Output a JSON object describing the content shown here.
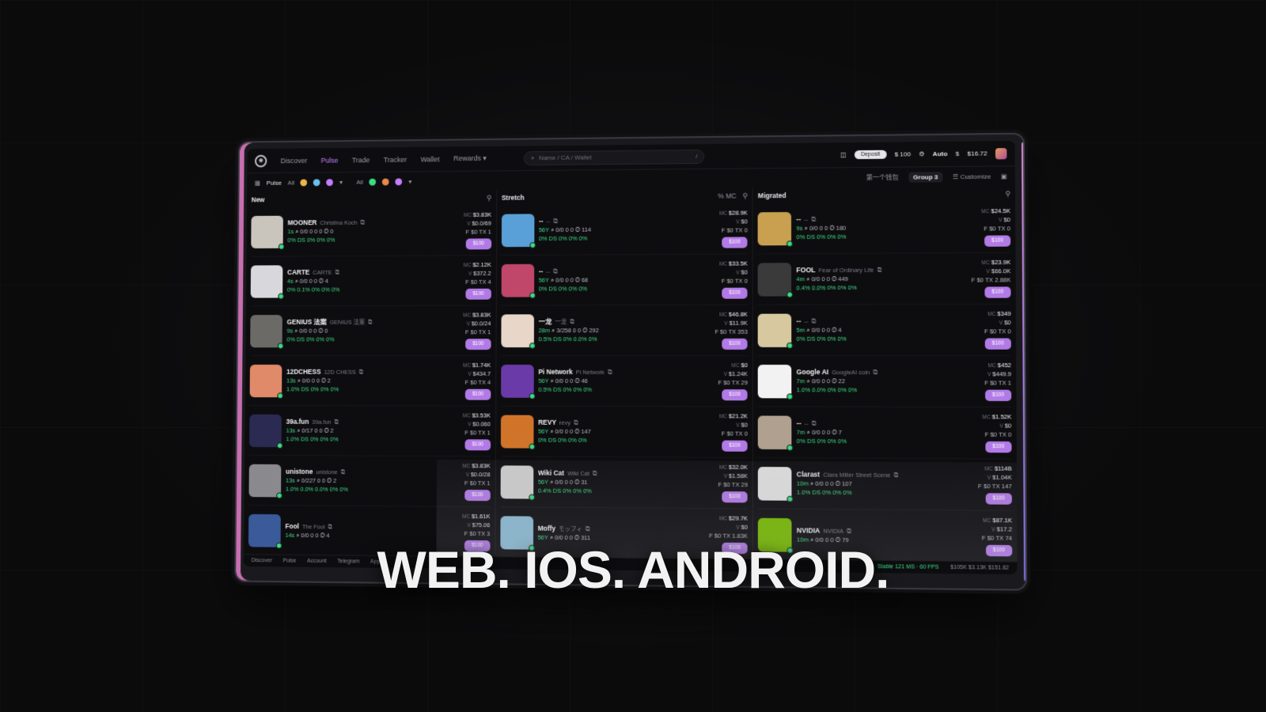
{
  "nav": {
    "items": [
      "Discover",
      "Pulse",
      "Trade",
      "Tracker",
      "Wallet",
      "Rewards"
    ],
    "active": "Pulse"
  },
  "search": {
    "placeholder": "Name / CA / Wallet",
    "shortcut": "/"
  },
  "header_tools": {
    "deposit": "Deposit",
    "balance": "$ 100",
    "auto": "Auto",
    "sol": "$",
    "wallet_value": "$16.72"
  },
  "subbar": {
    "title": "Pulse",
    "filter_all_1": "All",
    "filter_all_2": "All",
    "wallet_group": "第一个钱包",
    "group": "Group 3",
    "customize": "Customize"
  },
  "columns": [
    {
      "title": "New",
      "head_right": "",
      "rows": [
        {
          "ticker": "MOONER",
          "name": "Christina Koch",
          "age": "1s",
          "stats": "0/0  0  0  0",
          "holders": "0",
          "pct": "0%  DS  0%  0%  0%",
          "mc": "$3.83K",
          "vol": "$0.0/69",
          "f": "$0",
          "tx": "1",
          "buy": "$100",
          "color": "#c9c4bc"
        },
        {
          "ticker": "CARTE",
          "name": "CARTE",
          "age": "4s",
          "stats": "0/0  0  0",
          "holders": "4",
          "pct": "0%  0.1%  0%  0%  0%",
          "mc": "$2.12K",
          "vol": "$372.2",
          "f": "$0",
          "tx": "4",
          "buy": "$100",
          "color": "#d8d8dc"
        },
        {
          "ticker": "GENIUS 法案",
          "name": "GENIUS 法案",
          "age": "9s",
          "stats": "0/0  0  0",
          "holders": "0",
          "pct": "0%  DS  0%  0%  0%",
          "mc": "$3.83K",
          "vol": "$0.0/24",
          "f": "$0",
          "tx": "1",
          "buy": "$100",
          "color": "#6c6a66"
        },
        {
          "ticker": "12DCHESS",
          "name": "12D CHESS",
          "age": "13s",
          "stats": "0/0  0  0",
          "holders": "2",
          "pct": "1.0%  DS  0%  0%  0%",
          "mc": "$1.74K",
          "vol": "$434.7",
          "f": "$0",
          "tx": "4",
          "buy": "$100",
          "color": "#e08a6a"
        },
        {
          "ticker": "39a.fun",
          "name": "39a.fun",
          "age": "13s",
          "stats": "0/17  0  0",
          "holders": "2",
          "pct": "1.0%  DS  0%  0%  0%",
          "mc": "$3.53K",
          "vol": "$0.060",
          "f": "$0",
          "tx": "1",
          "buy": "$100",
          "color": "#2a2a52"
        },
        {
          "ticker": "unistone",
          "name": "unistone",
          "age": "13s",
          "stats": "0/227  0  0",
          "holders": "2",
          "pct": "1.0%  0.0%  0.0%  0%  0%",
          "mc": "$3.83K",
          "vol": "$0.0/28",
          "f": "$0",
          "tx": "1",
          "buy": "$100",
          "color": "#8a8a8e"
        },
        {
          "ticker": "Fool",
          "name": "The Fool",
          "age": "14s",
          "stats": "0/0  0  0",
          "holders": "4",
          "pct": "",
          "mc": "$1.61K",
          "vol": "$75.06",
          "f": "$0",
          "tx": "3",
          "buy": "$100",
          "color": "#3a5a9a"
        }
      ]
    },
    {
      "title": "Stretch",
      "head_right": "% MC",
      "rows": [
        {
          "ticker": "--",
          "name": "--",
          "age": "56Y",
          "stats": "0/0  0  0",
          "holders": "114",
          "pct": "0%  DS  0%  0%  0%",
          "mc": "$28.9K",
          "vol": "$0",
          "f": "$0",
          "tx": "0",
          "buy": "$100",
          "color": "#5aa0d8"
        },
        {
          "ticker": "--",
          "name": "--",
          "age": "56Y",
          "stats": "0/0  0  0",
          "holders": "68",
          "pct": "0%  DS  0%  0%  0%",
          "mc": "$33.5K",
          "vol": "$0",
          "f": "$0",
          "tx": "0",
          "buy": "$100",
          "color": "#c0466a"
        },
        {
          "ticker": "一龙",
          "name": "一龙",
          "age": "28m",
          "stats": "3/258  0  0",
          "holders": "292",
          "pct": "0.5%  DS  0%  0.0%  0%",
          "mc": "$46.8K",
          "vol": "$11.9K",
          "f": "$0",
          "tx": "353",
          "buy": "$100",
          "color": "#e8d6c8"
        },
        {
          "ticker": "Pi Network",
          "name": "Pi Network",
          "age": "56Y",
          "stats": "0/0  0  0",
          "holders": "46",
          "pct": "0.5%  DS  0%  0%  0%",
          "mc": "$0",
          "vol": "$1.24K",
          "f": "$0",
          "tx": "29",
          "buy": "$100",
          "color": "#6a3aa8"
        },
        {
          "ticker": "REVY",
          "name": "revy",
          "age": "56Y",
          "stats": "0/0  0  0",
          "holders": "147",
          "pct": "0%  DS  0%  0%  0%",
          "mc": "$21.2K",
          "vol": "$0",
          "f": "$0",
          "tx": "0",
          "buy": "$100",
          "color": "#d0742a"
        },
        {
          "ticker": "Wiki Cat",
          "name": "Wiki Cat",
          "age": "56Y",
          "stats": "0/0  0  0",
          "holders": "31",
          "pct": "0.4%  DS  0%  0%  0%",
          "mc": "$32.0K",
          "vol": "$1.58K",
          "f": "$0",
          "tx": "29",
          "buy": "$100",
          "color": "#cfcfcf"
        },
        {
          "ticker": "Moffy",
          "name": "モッフィ",
          "age": "56Y",
          "stats": "0/0  0  0",
          "holders": "311",
          "pct": "",
          "mc": "$29.7K",
          "vol": "$0",
          "f": "$0",
          "tx": "1.83K",
          "buy": "$100",
          "color": "#8ab8d0"
        }
      ]
    },
    {
      "title": "Migrated",
      "head_right": "",
      "rows": [
        {
          "ticker": "--",
          "name": "--",
          "age": "9s",
          "stats": "0/0  0  0",
          "holders": "180",
          "pct": "0%  DS  0%  0%  0%",
          "mc": "$24.5K",
          "vol": "$0",
          "f": "$0",
          "tx": "0",
          "buy": "$100",
          "color": "#c9a050"
        },
        {
          "ticker": "FOOL",
          "name": "Fear of Ordinary Life",
          "age": "4m",
          "stats": "0/0  0  0",
          "holders": "449",
          "pct": "0.4%  0.0%  0%  0%  0%",
          "mc": "$23.9K",
          "vol": "$66.0K",
          "f": "$0",
          "tx": "2.88K",
          "buy": "$100",
          "color": "#3a3a3a"
        },
        {
          "ticker": "--",
          "name": "--",
          "age": "5m",
          "stats": "0/0  0  0",
          "holders": "4",
          "pct": "0%  DS  0%  0%  0%",
          "mc": "$349",
          "vol": "$0",
          "f": "$0",
          "tx": "0",
          "buy": "$100",
          "color": "#d8c8a0"
        },
        {
          "ticker": "Google AI",
          "name": "GoogleAI coin",
          "age": "7m",
          "stats": "0/0  0  0",
          "holders": "22",
          "pct": "1.0%  0.0%  0%  0%  0%",
          "mc": "$452",
          "vol": "$449.9",
          "f": "$0",
          "tx": "1",
          "buy": "$100",
          "color": "#f2f2f2"
        },
        {
          "ticker": "--",
          "name": "--",
          "age": "7m",
          "stats": "0/0  0  0",
          "holders": "7",
          "pct": "0%  DS  0%  0%  0%",
          "mc": "$1.52K",
          "vol": "$0",
          "f": "$0",
          "tx": "0",
          "buy": "$100",
          "color": "#b0a090"
        },
        {
          "ticker": "Clarast",
          "name": "Clara Miller Street Scene",
          "age": "10m",
          "stats": "0/0  0  0",
          "holders": "107",
          "pct": "1.0%  DS  0%  0%  0%",
          "mc": "$114B",
          "vol": "$1.04K",
          "f": "$0",
          "tx": "147",
          "buy": "$100",
          "color": "#e0e0e0"
        },
        {
          "ticker": "NVIDIA",
          "name": "NVIDIA",
          "age": "10m",
          "stats": "0/0  0  0",
          "holders": "79",
          "pct": "",
          "mc": "$87.1K",
          "vol": "$17.2",
          "f": "$0",
          "tx": "74",
          "buy": "$100",
          "color": "#76b900"
        }
      ]
    }
  ],
  "bottombar": {
    "items": [
      "Discover",
      "Pulse",
      "Account",
      "Telegram",
      "App"
    ],
    "stable": "Stable 121 MS · 60 FPS",
    "prices": "$105K  $3.13K  $151.82"
  },
  "headline": "WEB. IOS. ANDROID."
}
